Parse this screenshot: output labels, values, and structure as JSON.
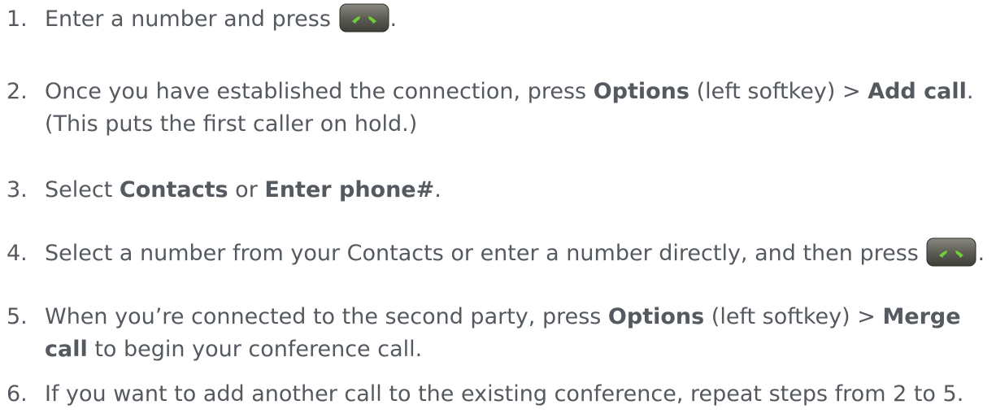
{
  "steps": [
    {
      "number": "1.",
      "text_before": "Enter a number and press ",
      "icon": "phone-call-key-icon",
      "text_after": "."
    },
    {
      "number": "2.",
      "text_a": "Once you have established the connection, press ",
      "bold_a": "Options",
      "text_b": " (left softkey) > ",
      "bold_b": "Add call",
      "text_c": ".",
      "line2": "(This puts the first caller on hold.)"
    },
    {
      "number": "3.",
      "text_a": "Select ",
      "bold_a": "Contacts",
      "text_b": " or ",
      "bold_b": "Enter phone#",
      "text_c": "."
    },
    {
      "number": "4.",
      "text_before": "Select a number from your Contacts or enter a number directly, and then press ",
      "icon": "phone-call-key-icon",
      "text_after": "."
    },
    {
      "number": "5.",
      "text_a": "When you’re connected to the second party, press ",
      "bold_a": "Options",
      "text_b": " (left softkey) > ",
      "bold_b": "Merge",
      "bold_c": "call",
      "line2_rest": " to begin your conference call."
    },
    {
      "number": "6.",
      "text": "If you want to add another call to the existing conference, repeat steps from 2 to 5."
    }
  ],
  "colors": {
    "text": "#555a60",
    "key_body": "#5e5e56",
    "key_handset": "#6fd13a"
  }
}
